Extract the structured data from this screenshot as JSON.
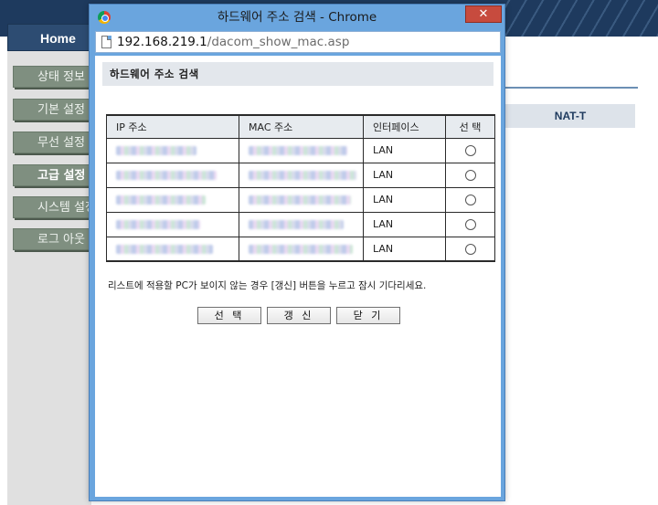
{
  "background": {
    "home_label": "Home",
    "menu": [
      {
        "label": "상태 정보",
        "active": false
      },
      {
        "label": "기본 설정",
        "active": false
      },
      {
        "label": "무선 설정",
        "active": false
      },
      {
        "label": "고급 설정",
        "active": true
      },
      {
        "label": "시스템 설정",
        "active": false
      },
      {
        "label": "로그 아웃",
        "active": false
      }
    ],
    "tab_label": "NAT-T"
  },
  "window": {
    "title": "하드웨어 주소 검색 - Chrome",
    "close_glyph": "✕",
    "url_host": "192.168.219.1",
    "url_path": "/dacom_show_mac.asp"
  },
  "page": {
    "header": "하드웨어 주소 검색",
    "table": {
      "columns": [
        "IP 주소",
        "MAC 주소",
        "인터페이스",
        "선 택"
      ],
      "rows": [
        {
          "interface": "LAN"
        },
        {
          "interface": "LAN"
        },
        {
          "interface": "LAN"
        },
        {
          "interface": "LAN"
        },
        {
          "interface": "LAN"
        }
      ]
    },
    "notice": "리스트에 적용할 PC가 보이지 않는 경우 [갱신] 버튼을 누르고 잠시 기다리세요.",
    "buttons": {
      "select": "선 택",
      "refresh": "갱 신",
      "close": "닫 기"
    }
  },
  "colors": {
    "window_frame": "#6aa5de",
    "close_button": "#c74b3e",
    "header_bar": "#e3e7ec",
    "admin_topbar": "#1e3a5e",
    "menu_button": "#7f8f80"
  }
}
